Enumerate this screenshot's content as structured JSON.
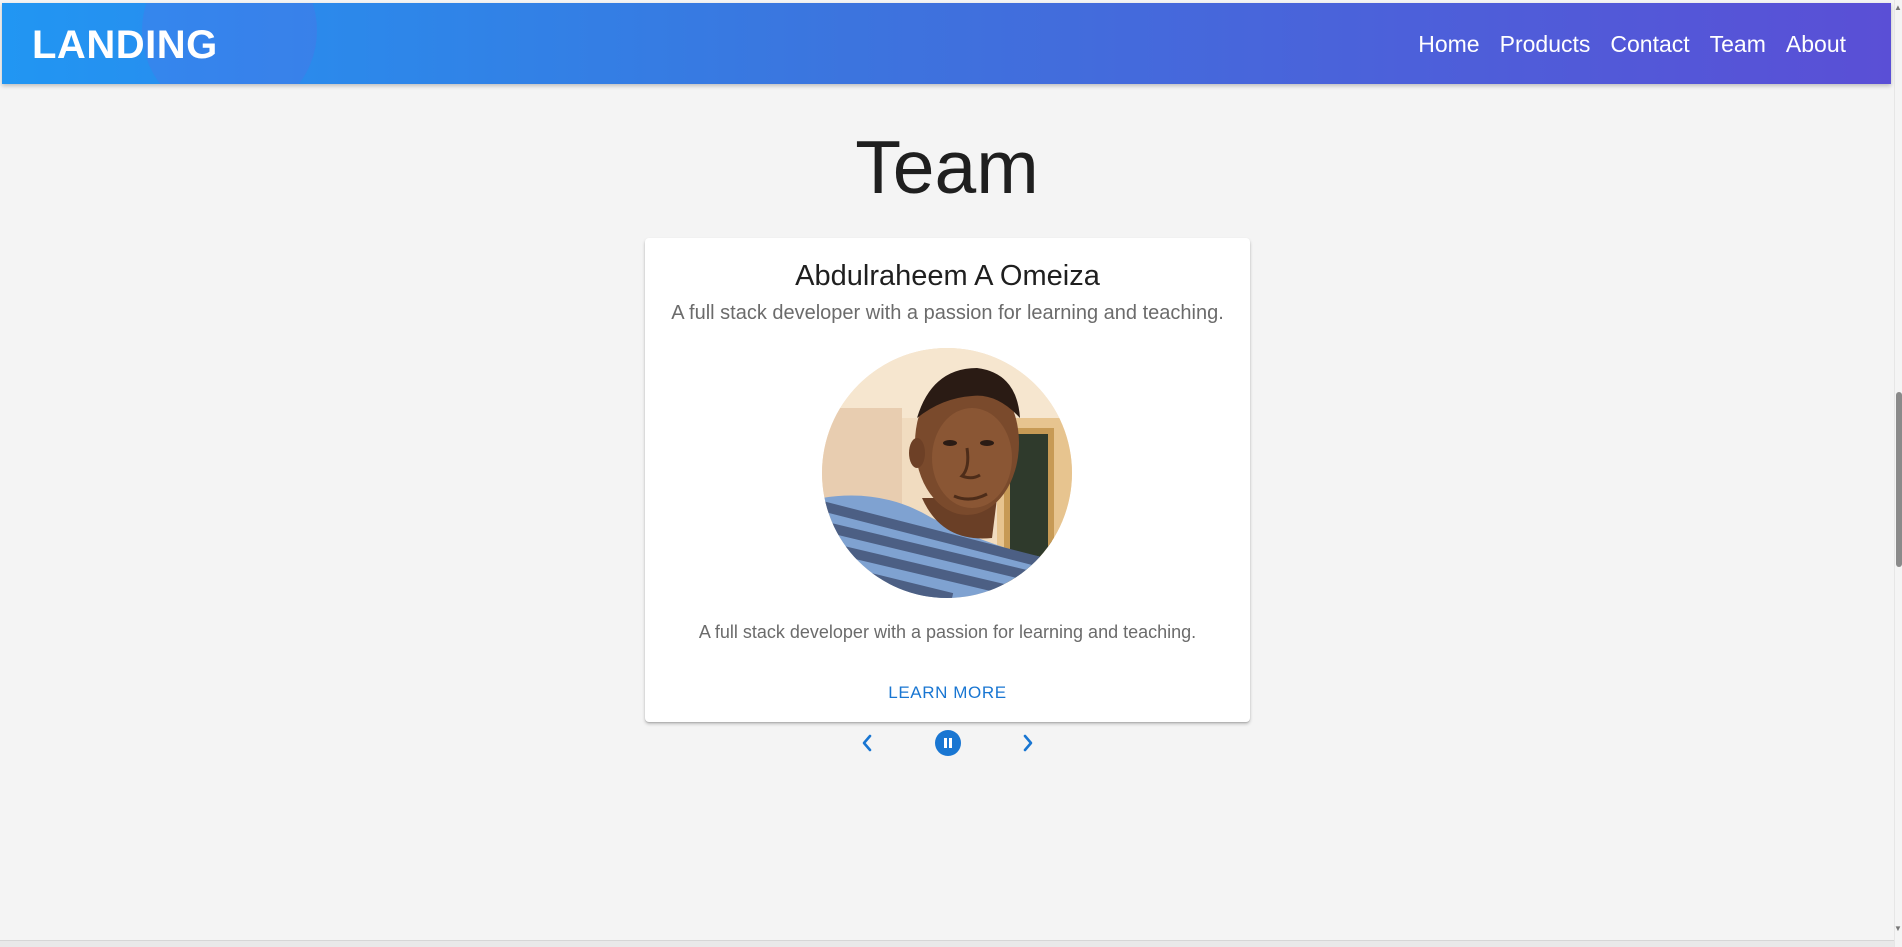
{
  "header": {
    "logo": "LANDING",
    "nav": [
      "Home",
      "Products",
      "Contact",
      "Team",
      "About"
    ],
    "gradient_start": "#2196f3",
    "gradient_end": "#5a4fd6"
  },
  "section": {
    "title": "Team"
  },
  "carousel": {
    "card": {
      "name": "Abdulraheem A Omeiza",
      "subtitle": "A full stack developer with a passion for learning and teaching.",
      "description": "A full stack developer with a passion for learning and teaching.",
      "action_label": "LEARN MORE"
    },
    "controls": {
      "prev_icon": "chevron-left-icon",
      "pause_icon": "pause-icon",
      "next_icon": "chevron-right-icon"
    },
    "accent_color": "#1976d2"
  }
}
